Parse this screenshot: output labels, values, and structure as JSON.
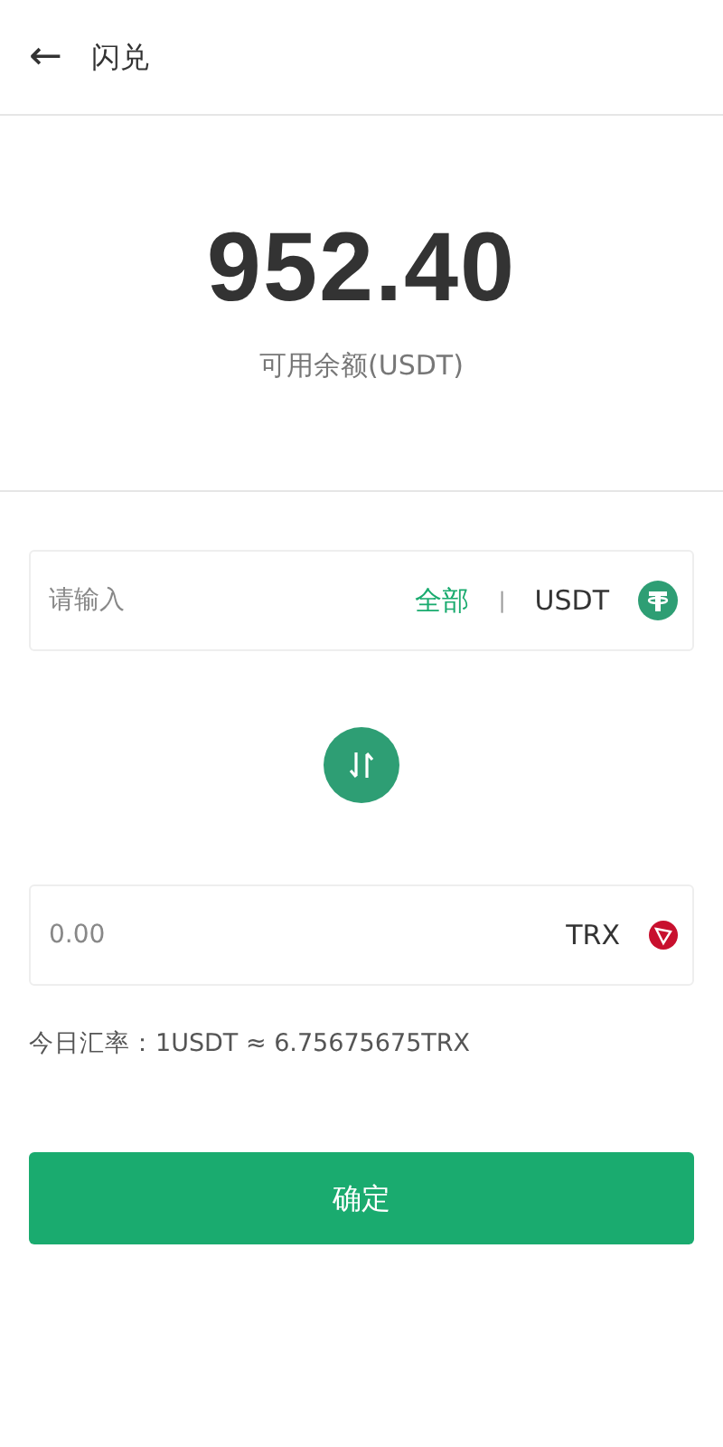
{
  "header": {
    "back": "←",
    "title": "闪兑"
  },
  "balance": {
    "amount": "952.40",
    "label": "可用余额(USDT)"
  },
  "fields": [
    {
      "kind": "source",
      "placeholder": "请输入",
      "all_label": "全部",
      "separator": "|",
      "currency": "USDT"
    },
    {
      "kind": "target",
      "placeholder": "0.00",
      "currency": "TRX"
    }
  ],
  "rate": "今日汇率：1USDT ≈ 6.75675675TRX",
  "confirm": "确定"
}
